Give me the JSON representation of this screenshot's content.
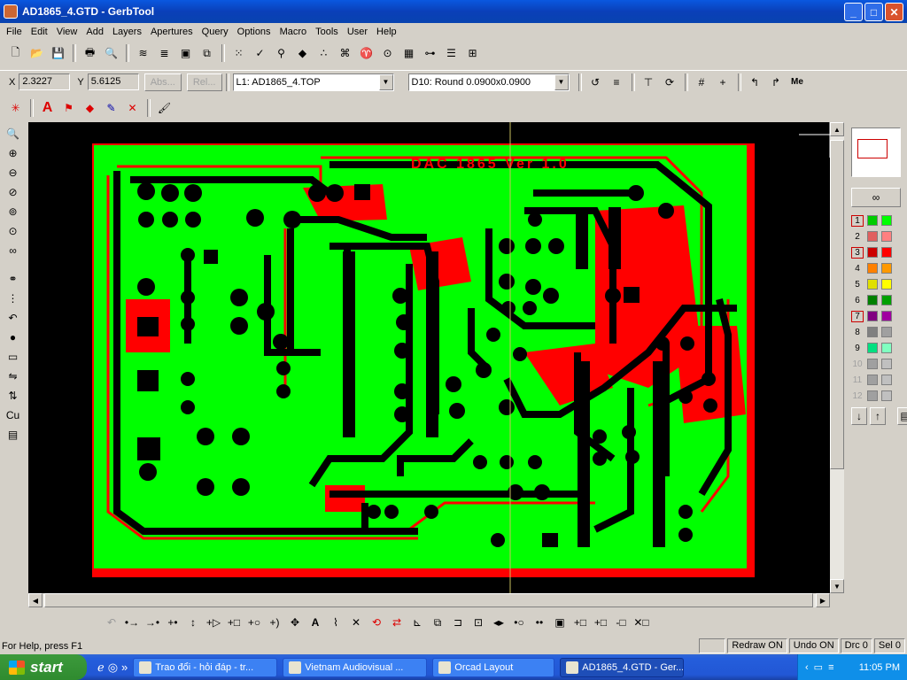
{
  "window": {
    "title": "AD1865_4.GTD - GerbTool"
  },
  "menu": [
    "File",
    "Edit",
    "View",
    "Add",
    "Layers",
    "Apertures",
    "Query",
    "Options",
    "Macro",
    "Tools",
    "User",
    "Help"
  ],
  "coords": {
    "x_label": "X",
    "x_value": "2.3227",
    "y_label": "Y",
    "y_value": "5.6125",
    "abs_button": "Abs...",
    "rel_button": "Rel..."
  },
  "layer_select": "L1: AD1865_4.TOP",
  "aperture_select": "D10: Round 0.0900x0.0900",
  "me_button": "Me",
  "layers_panel": {
    "rows": [
      {
        "num": "1",
        "active": true,
        "c1": "#00cc00",
        "c2": "#00ff00"
      },
      {
        "num": "2",
        "active": false,
        "c1": "#e06060",
        "c2": "#ff8080"
      },
      {
        "num": "3",
        "active": true,
        "c1": "#cc0000",
        "c2": "#ff0000"
      },
      {
        "num": "4",
        "active": false,
        "c1": "#ff8000",
        "c2": "#ff9900"
      },
      {
        "num": "5",
        "active": false,
        "c1": "#e0e000",
        "c2": "#ffff00"
      },
      {
        "num": "6",
        "active": false,
        "c1": "#008000",
        "c2": "#00a000"
      },
      {
        "num": "7",
        "active": true,
        "c1": "#800080",
        "c2": "#a000a0"
      },
      {
        "num": "8",
        "active": false,
        "c1": "#808080",
        "c2": "#a0a0a0"
      },
      {
        "num": "9",
        "active": false,
        "c1": "#00e080",
        "c2": "#80ffc0"
      },
      {
        "num": "10",
        "active": false,
        "dim": true,
        "c1": "#a0a0a0",
        "c2": "#c0c0c0"
      },
      {
        "num": "11",
        "active": false,
        "dim": true,
        "c1": "#a0a0a0",
        "c2": "#c0c0c0"
      },
      {
        "num": "12",
        "active": false,
        "dim": true,
        "c1": "#a0a0a0",
        "c2": "#c0c0c0"
      }
    ]
  },
  "pcb_text": "DAC 1865 Ver 1.0",
  "statusbar": {
    "help": "For Help, press F1",
    "redraw": "Redraw ON",
    "undo": "Undo ON",
    "drc": "Drc 0",
    "sel": "Sel 0"
  },
  "taskbar": {
    "start": "start",
    "tasks": [
      {
        "label": "Trao đổi - hỏi đáp - tr...",
        "active": false
      },
      {
        "label": "Vietnam Audiovisual ...",
        "active": false
      },
      {
        "label": "Orcad Layout",
        "active": false
      },
      {
        "label": "AD1865_4.GTD - Ger...",
        "active": true
      }
    ],
    "clock": "11:05 PM"
  },
  "colors": {
    "board": "#00ff00",
    "copper": "#ff0000",
    "background": "#000000",
    "crosshair": "#c8c060"
  }
}
